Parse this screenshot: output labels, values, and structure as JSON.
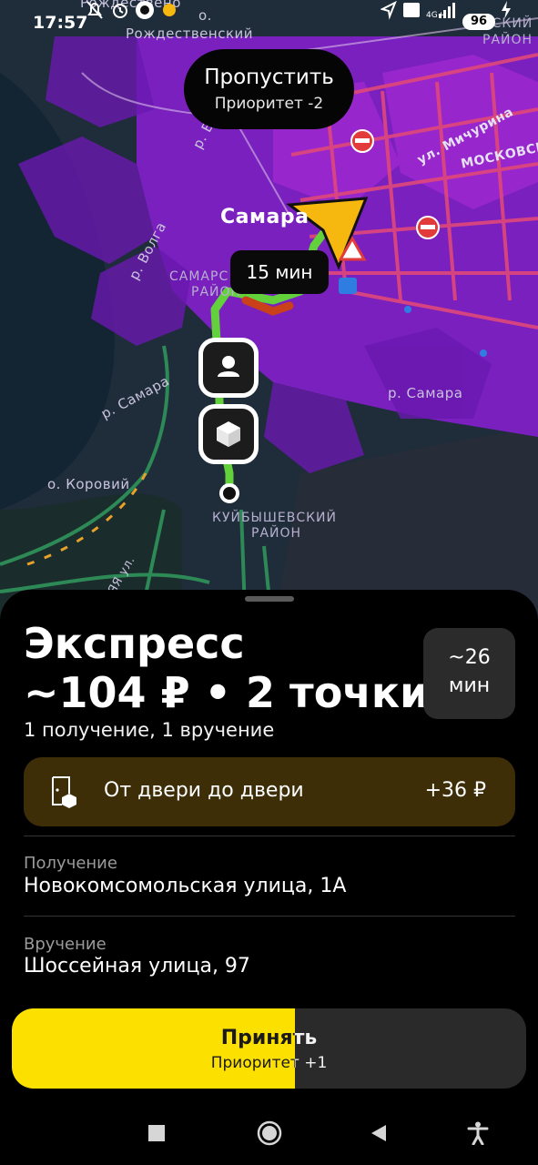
{
  "status_bar": {
    "time": "17:57",
    "battery": "96",
    "network": "4G+"
  },
  "map": {
    "labels": {
      "rozhdestveno": "Рождествено",
      "island": "о.",
      "rozhdestvensky": "Рождественский",
      "district_right_top": "ВСКИЙ",
      "district_right": "РАЙОН",
      "volga_1": "р. Волга",
      "volga_2": "р. Волга",
      "michurina": "ул. Мичурина",
      "moskovskoe": "МОСКОВСК",
      "samara_city": "Самара",
      "samara_district_1": "САМАРС",
      "samara_district_2": "РАЙОН",
      "samara_river_left": "р. Самара",
      "samara_river_right": "р. Самара",
      "korovy_island": "о. Коровий",
      "kuibyshev_1": "КУЙБЫШЕВСКИЙ",
      "kuibyshev_2": "РАЙОН",
      "street_bottom": "ЯЯ ул."
    },
    "skip": {
      "title": "Пропустить",
      "subtitle": "Приоритет -2"
    },
    "eta": "15 мин",
    "route_color": "#62d13b",
    "demand_color": "#8a1fd6"
  },
  "order": {
    "title": "Экспресс",
    "price_line": "~104 ₽ • 2 точки",
    "summary": "1 получение, 1 вручение",
    "duration_value": "~26",
    "duration_unit": "мин",
    "door_option": {
      "label": "От двери до двери",
      "price": "+36 ₽",
      "icon": "door-to-door-icon"
    },
    "pickup": {
      "label": "Получение",
      "address": "Новокомсомольская улица, 1А"
    },
    "delivery": {
      "label": "Вручение",
      "address": "Шоссейная улица, 97"
    }
  },
  "accept": {
    "title": "Принять",
    "subtitle": "Приоритет +1",
    "progress": 0.55,
    "color": "#fce000"
  },
  "nav": {
    "recents_icon": "square-icon",
    "home_icon": "circle-icon",
    "back_icon": "triangle-back-icon",
    "accessibility_icon": "accessibility-icon"
  }
}
